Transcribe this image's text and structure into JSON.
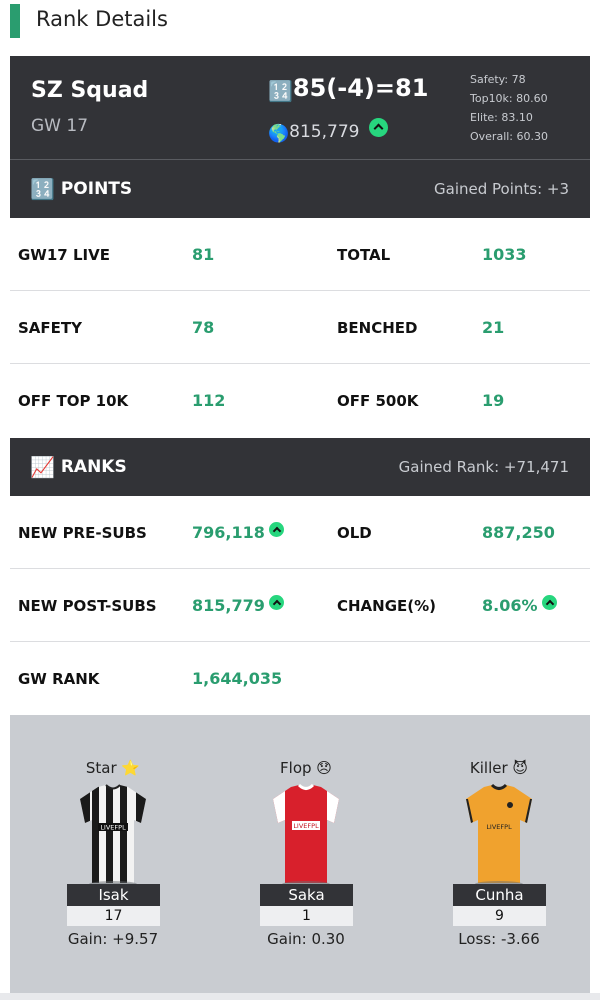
{
  "header": {
    "title": "Rank Details"
  },
  "team": {
    "name": "SZ Squad",
    "gw": "GW 17",
    "rank_emoji": "🔢",
    "rank_formula": "85(-4)=81",
    "globe_emoji": "🌎",
    "overall_rank": "815,779",
    "stats": [
      "Safety: 78",
      "Top10k: 80.60",
      "Elite: 83.10",
      "Overall: 60.30"
    ]
  },
  "points_section": {
    "emoji": "🔢",
    "label": "POINTS",
    "gained": "Gained Points: +3",
    "rows": [
      {
        "l1": "GW17 LIVE",
        "v1": "81",
        "l2": "TOTAL",
        "v2": "1033"
      },
      {
        "l1": "SAFETY",
        "v1": "78",
        "l2": "BENCHED",
        "v2": "21"
      },
      {
        "l1": "OFF TOP 10K",
        "v1": "112",
        "l2": "OFF 500K",
        "v2": "19"
      }
    ]
  },
  "ranks_section": {
    "emoji": "📈",
    "label": "RANKS",
    "gained": "Gained Rank: +71,471",
    "rows": [
      {
        "l1": "NEW PRE-SUBS",
        "v1": "796,118",
        "l2": "OLD",
        "v2": "887,250"
      },
      {
        "l1": "NEW POST-SUBS",
        "v1": "815,779",
        "l2": "CHANGE(%)",
        "v2": "8.06%"
      },
      {
        "l1": "GW RANK",
        "v1": "1,644,035"
      }
    ]
  },
  "players": [
    {
      "title": "Star ⭐",
      "name": "Isak",
      "points": "17",
      "gain": "Gain: +9.57",
      "sponsor": "LIVEFPL"
    },
    {
      "title": "Flop 😞",
      "name": "Saka",
      "points": "1",
      "gain": "Gain: 0.30",
      "sponsor": "LIVEFPL"
    },
    {
      "title": "Killer 😈",
      "name": "Cunha",
      "points": "9",
      "gain": "Loss: -3.66",
      "sponsor": "LIVEFPL"
    }
  ],
  "colors": {
    "accent": "#2a9d6f",
    "banner": "#323337",
    "up_badge": "#27d67e"
  },
  "icons": {
    "trend_up": "chevron-up-circle-icon"
  }
}
